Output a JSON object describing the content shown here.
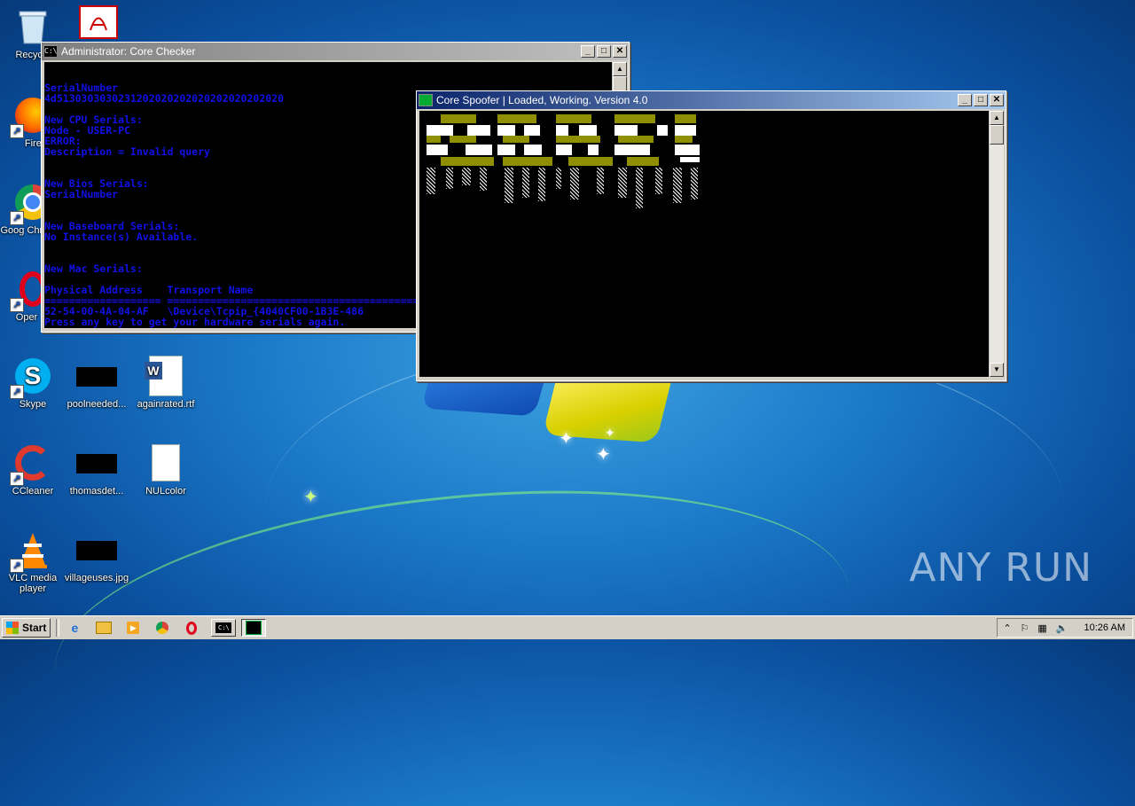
{
  "desktop": {
    "icons": [
      {
        "label": "Recycle"
      },
      {
        "label": ""
      },
      {
        "label": "Firefo"
      },
      {
        "label": "Goog Chrom"
      },
      {
        "label": "Oper"
      },
      {
        "label": "Skype"
      },
      {
        "label": "poolneeded..."
      },
      {
        "label": "againrated.rtf"
      },
      {
        "label": "CCleaner"
      },
      {
        "label": "thomasdet..."
      },
      {
        "label": "NULcolor"
      },
      {
        "label": "VLC media player"
      },
      {
        "label": "villageuses.jpg"
      }
    ],
    "watermark": "ANY RUN"
  },
  "checker_window": {
    "title": "Administrator:  Core Checker",
    "lines": [
      "SerialNumber",
      "4d5130303030231202020202020202020202020",
      "",
      "New CPU Serials:",
      "Node - USER-PC",
      "ERROR:",
      "Description = Invalid query",
      "",
      "",
      "New Bios Serials:",
      "SerialNumber",
      "",
      "",
      "New Baseboard Serials:",
      "No Instance(s) Available.",
      "",
      "",
      "New Mac Serials:",
      "",
      "Physical Address    Transport Name",
      "=================== ==========================================================",
      "52-54-00-4A-04-AF   \\Device\\Tcpip_{4040CF00-1B3E-486",
      "Press any key to get your hardware serials again."
    ]
  },
  "spoofer_window": {
    "title": "Core Spoofer | Loaded, Working. Version 4.0"
  },
  "taskbar": {
    "start_label": "Start",
    "clock": "10:26 AM"
  },
  "colors": {
    "console_text": "#1111e8",
    "art_olive": "#8f8f00",
    "art_white": "#ffffff"
  }
}
